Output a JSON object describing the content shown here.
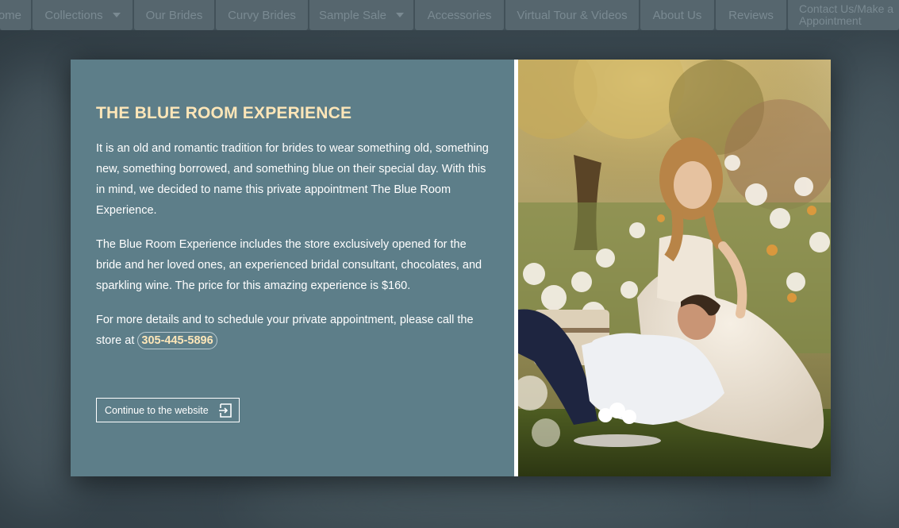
{
  "nav": {
    "items": [
      {
        "label": "ome",
        "dropdown": false
      },
      {
        "label": "Collections",
        "dropdown": true
      },
      {
        "label": "Our Brides",
        "dropdown": false
      },
      {
        "label": "Curvy Brides",
        "dropdown": false
      },
      {
        "label": "Sample Sale",
        "dropdown": true
      },
      {
        "label": "Accessories",
        "dropdown": false
      },
      {
        "label": "Virtual Tour & Videos",
        "dropdown": false
      },
      {
        "label": "About Us",
        "dropdown": false
      },
      {
        "label": "Reviews",
        "dropdown": false
      }
    ],
    "contact_line1": "Contact Us/Make a",
    "contact_line2": "Appointment"
  },
  "modal": {
    "title": "THE BLUE ROOM EXPERIENCE",
    "paragraph1": "It is an old and romantic tradition for brides to wear something old, something new, something borrowed, and something blue on their special day. With this in mind, we decided to name this private appointment The Blue Room Experience.",
    "paragraph2": "The Blue Room Experience includes the store exclusively opened for the bride and her loved ones, an experienced bridal consultant, chocolates, and sparkling wine. The price for this amazing experience is $160.",
    "paragraph3_prefix": "For more details and to schedule your private appointment, please call the store at",
    "phone": "305-445-5896",
    "continue_label": "Continue to the website"
  },
  "icons": {
    "caret": "chevron-down-icon",
    "exit": "exit-icon"
  },
  "colors": {
    "panel": "#5d7e89",
    "title": "#fde6b8",
    "nav_item": "#56666e"
  }
}
